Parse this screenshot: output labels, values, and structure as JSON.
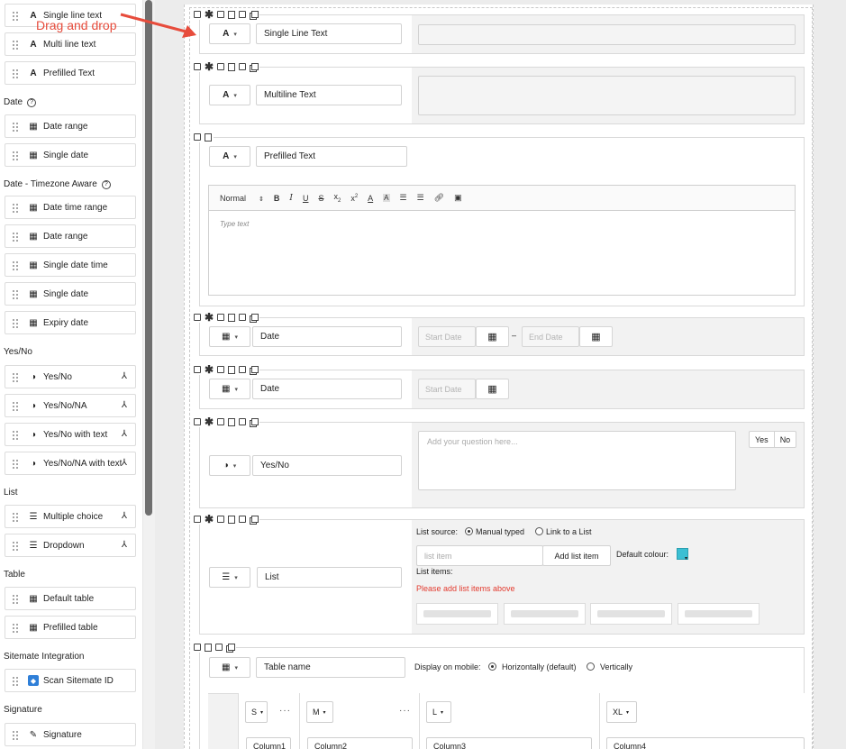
{
  "annotation": "Drag and drop",
  "sidebar": {
    "items_top": [
      {
        "label": "Single line text",
        "icon": "text-icon"
      },
      {
        "label": "Multi line text",
        "icon": "text-icon"
      },
      {
        "label": "Prefilled Text",
        "icon": "text-icon"
      }
    ],
    "section_date": "Date",
    "date_items": [
      {
        "label": "Date range",
        "icon": "calendar-icon"
      },
      {
        "label": "Single date",
        "icon": "calendar-icon"
      }
    ],
    "section_tz": "Date - Timezone Aware",
    "tz_items": [
      {
        "label": "Date time range",
        "icon": "calendar-clock-icon"
      },
      {
        "label": "Date range",
        "icon": "calendar-clock-icon"
      },
      {
        "label": "Single date time",
        "icon": "calendar-clock-icon"
      },
      {
        "label": "Single date",
        "icon": "calendar-clock-icon"
      },
      {
        "label": "Expiry date",
        "icon": "calendar-clock-icon"
      }
    ],
    "section_yesno": "Yes/No",
    "yesno_items": [
      {
        "label": "Yes/No",
        "icon": "contrast-icon"
      },
      {
        "label": "Yes/No/NA",
        "icon": "contrast-icon"
      },
      {
        "label": "Yes/No with text",
        "icon": "contrast-icon"
      },
      {
        "label": "Yes/No/NA with text",
        "icon": "contrast-icon"
      }
    ],
    "section_list": "List",
    "list_items": [
      {
        "label": "Multiple choice",
        "icon": "list-icon"
      },
      {
        "label": "Dropdown",
        "icon": "list-icon"
      }
    ],
    "section_table": "Table",
    "table_items": [
      {
        "label": "Default table",
        "icon": "table-icon"
      },
      {
        "label": "Prefilled table",
        "icon": "table-icon"
      }
    ],
    "section_sitemate": "Sitemate Integration",
    "sitemate_items": [
      {
        "label": "Scan Sitemate ID",
        "icon": "sitemate-icon"
      }
    ],
    "section_signature": "Signature",
    "signature_items": [
      {
        "label": "Signature",
        "icon": "signature-icon"
      }
    ]
  },
  "form": {
    "single_line": {
      "name": "Single Line Text"
    },
    "multiline": {
      "name": "Multiline Text"
    },
    "prefilled": {
      "name": "Prefilled Text",
      "format": "Normal",
      "placeholder": "Type text"
    },
    "date_range": {
      "name": "Date",
      "start": "Start Date",
      "end": "End Date",
      "sep": "–"
    },
    "single_date": {
      "name": "Date",
      "start": "Start Date"
    },
    "yesno": {
      "name": "Yes/No",
      "question_placeholder": "Add your question here...",
      "yes": "Yes",
      "no": "No"
    },
    "list": {
      "name": "List",
      "source_label": "List source:",
      "opt_manual": "Manual typed",
      "opt_link": "Link to a List",
      "item_placeholder": "list item",
      "add_button": "Add list item",
      "default_colour": "Default colour:",
      "colour": "#3bbfd3",
      "items_label": "List items:",
      "error": "Please add list items above"
    },
    "table": {
      "name": "Table name",
      "display_label": "Display on mobile:",
      "opt_horizontal": "Horizontally (default)",
      "opt_vertical": "Vertically",
      "columns": [
        {
          "size": "S",
          "name": "Column1"
        },
        {
          "size": "M",
          "name": "Column2"
        },
        {
          "size": "L",
          "name": "Column3"
        },
        {
          "size": "XL",
          "name": "Column4"
        }
      ]
    }
  }
}
